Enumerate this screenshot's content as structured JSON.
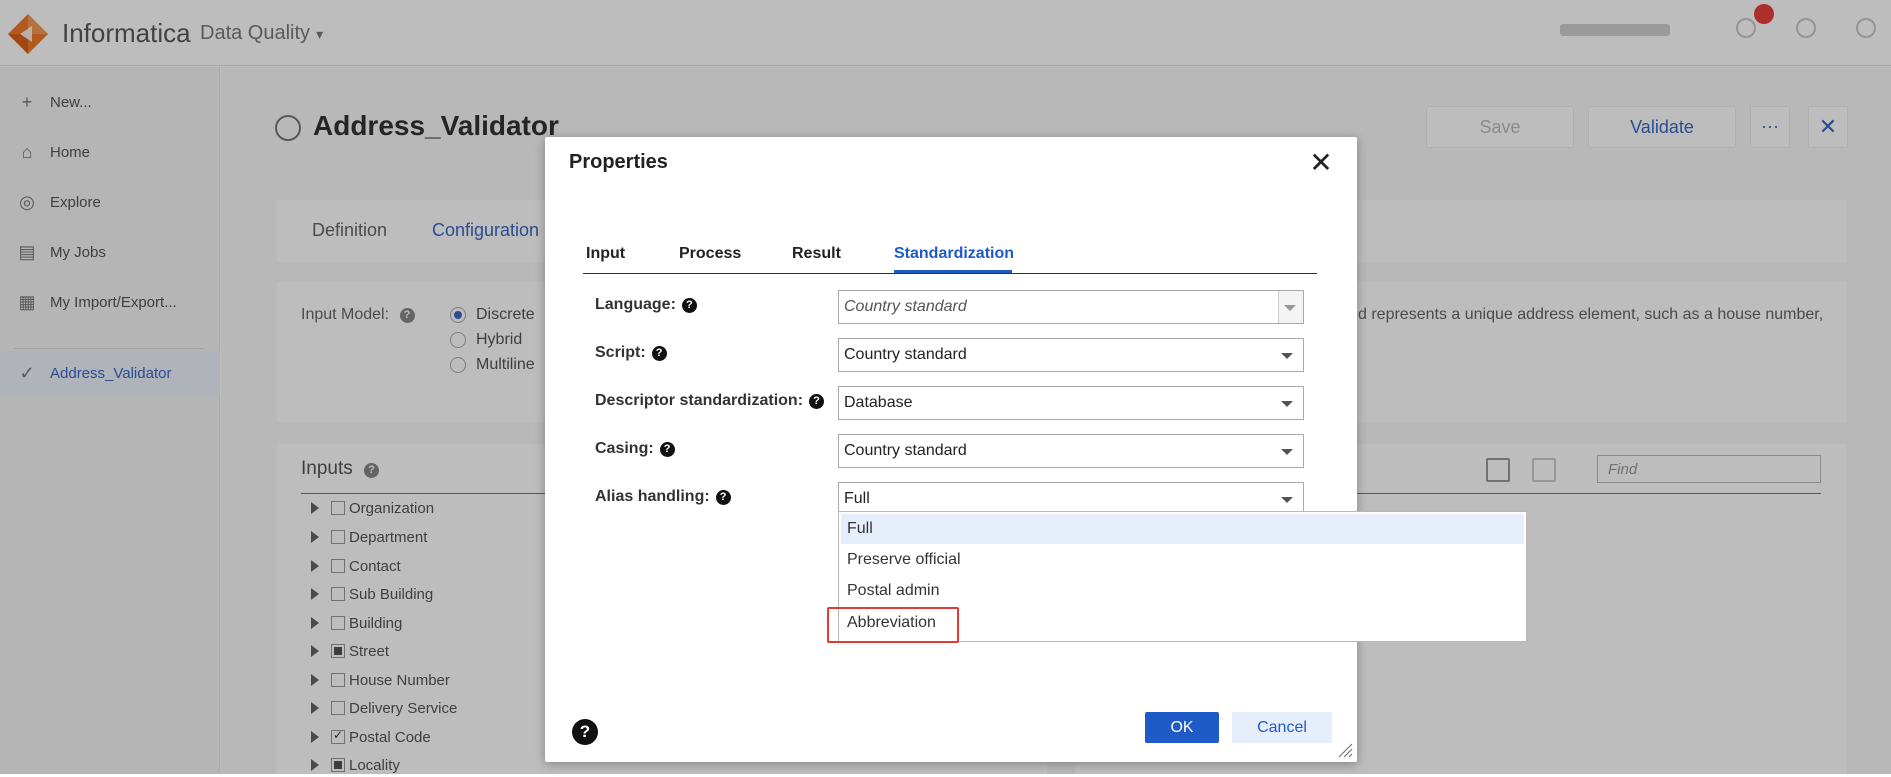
{
  "header": {
    "brand": "Informatica",
    "product": "Data Quality",
    "product_chevron": "chevron-down-icon"
  },
  "sidebar": {
    "items": [
      {
        "label": "New...",
        "icon": "plus-icon"
      },
      {
        "label": "Home",
        "icon": "home-icon"
      },
      {
        "label": "Explore",
        "icon": "compass-icon"
      },
      {
        "label": "My Jobs",
        "icon": "jobs-icon"
      },
      {
        "label": "My Import/Export...",
        "icon": "import-export-icon"
      },
      {
        "label": "Address_Validator",
        "icon": "check-badge-icon"
      }
    ]
  },
  "page": {
    "title": "Address_Validator",
    "save_label": "Save",
    "validate_label": "Validate",
    "more_label": "···",
    "close_label": "✕",
    "tabs": [
      "Definition",
      "Configuration"
    ],
    "input_model_label": "Input Model:",
    "input_model_options": [
      "Discrete",
      "Hybrid",
      "Multiline"
    ],
    "input_model_selected": "Discrete",
    "description": "d represents a unique address element, such as a house number,",
    "inputs_title": "Inputs",
    "find_placeholder": "Find",
    "tree": [
      {
        "label": "Organization",
        "state": "unchecked"
      },
      {
        "label": "Department",
        "state": "unchecked"
      },
      {
        "label": "Contact",
        "state": "unchecked"
      },
      {
        "label": "Sub Building",
        "state": "unchecked"
      },
      {
        "label": "Building",
        "state": "unchecked"
      },
      {
        "label": "Street",
        "state": "partial"
      },
      {
        "label": "House Number",
        "state": "unchecked"
      },
      {
        "label": "Delivery Service",
        "state": "unchecked"
      },
      {
        "label": "Postal Code",
        "state": "checked"
      },
      {
        "label": "Locality",
        "state": "partial"
      }
    ]
  },
  "dialog": {
    "title": "Properties",
    "close_label": "✕",
    "tabs": [
      "Input",
      "Process",
      "Result",
      "Standardization"
    ],
    "active_tab": "Standardization",
    "fields": [
      {
        "label": "Language:",
        "value": "Country standard",
        "disabled": true
      },
      {
        "label": "Script:",
        "value": "Country standard"
      },
      {
        "label": "Descriptor standardization:",
        "value": "Database"
      },
      {
        "label": "Casing:",
        "value": "Country standard"
      },
      {
        "label": "Alias handling:",
        "value": "Full"
      }
    ],
    "dropdown_options": [
      "Full",
      "Preserve official",
      "Postal admin",
      "Abbreviation"
    ],
    "dropdown_selected": "Full",
    "highlighted_option": "Abbreviation",
    "help_label": "?",
    "ok_label": "OK",
    "cancel_label": "Cancel"
  },
  "colors": {
    "accent": "#1f5bc6",
    "highlight": "#e53935",
    "logo_orange": "#f07a2a"
  }
}
